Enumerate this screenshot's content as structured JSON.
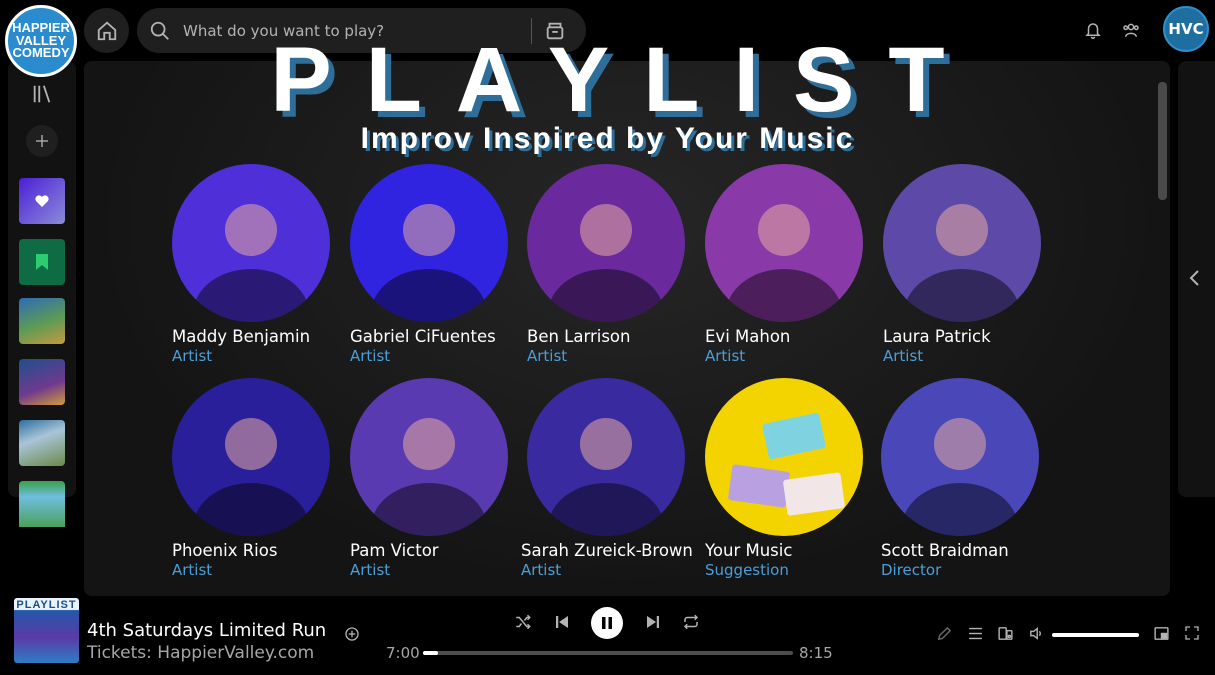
{
  "app": {
    "logo_lines": [
      "HAPPIER",
      "VALLEY",
      "COMEDY"
    ],
    "user_initials": "HVC"
  },
  "search": {
    "placeholder": "What do you want to play?"
  },
  "banner": {
    "headline": "PLAYLIST",
    "subheadline": "Improv Inspired by Your Music"
  },
  "cast": [
    {
      "name": "Maddy Benjamin",
      "role": "Artist",
      "color": "#4f2fd8"
    },
    {
      "name": "Gabriel CiFuentes",
      "role": "Artist",
      "color": "#3024e0"
    },
    {
      "name": "Ben Larrison",
      "role": "Artist",
      "color": "#6a2a9e"
    },
    {
      "name": "Evi Mahon",
      "role": "Artist",
      "color": "#8a3aa8"
    },
    {
      "name": "Laura Patrick",
      "role": "Artist",
      "color": "#5d4aa8"
    },
    {
      "name": "Phoenix Rios",
      "role": "Artist",
      "color": "#2a1f9a"
    },
    {
      "name": "Pam Victor",
      "role": "Artist",
      "color": "#5a3ab0"
    },
    {
      "name": "Sarah Zureick-Brown",
      "role": "Artist",
      "color": "#3a2aa0"
    },
    {
      "name": "Your Music",
      "role": "Suggestion",
      "color": "#f3d400"
    },
    {
      "name": "Scott Braidman",
      "role": "Director",
      "color": "#4a48b8"
    }
  ],
  "now_playing": {
    "art_label": "PLAYLIST",
    "title": "4th Saturdays Limited Run",
    "subtitle": "Tickets: HappierValley.com",
    "elapsed": "7:00",
    "duration": "8:15",
    "progress_fraction": 0.04,
    "volume_fraction": 1.0
  },
  "colors": {
    "accent_blue": "#4a9fd8",
    "headline_shadow": "#2e6e98",
    "background": "#000000",
    "panel": "#141414"
  },
  "icons": {
    "home": "home-icon",
    "search": "search-icon",
    "browse": "browse-icon",
    "bell": "bell-icon",
    "friends": "friends-icon",
    "library": "library-icon",
    "create": "plus-icon",
    "shuffle": "shuffle-icon",
    "previous": "skip-back-icon",
    "pause": "pause-icon",
    "next": "skip-forward-icon",
    "repeat": "repeat-icon",
    "now_playing_view": "pen-icon",
    "queue": "queue-icon",
    "devices": "connect-device-icon",
    "volume": "volume-icon",
    "miniplayer": "miniplayer-icon",
    "fullscreen": "fullscreen-icon",
    "expand": "chevron-left-icon"
  }
}
